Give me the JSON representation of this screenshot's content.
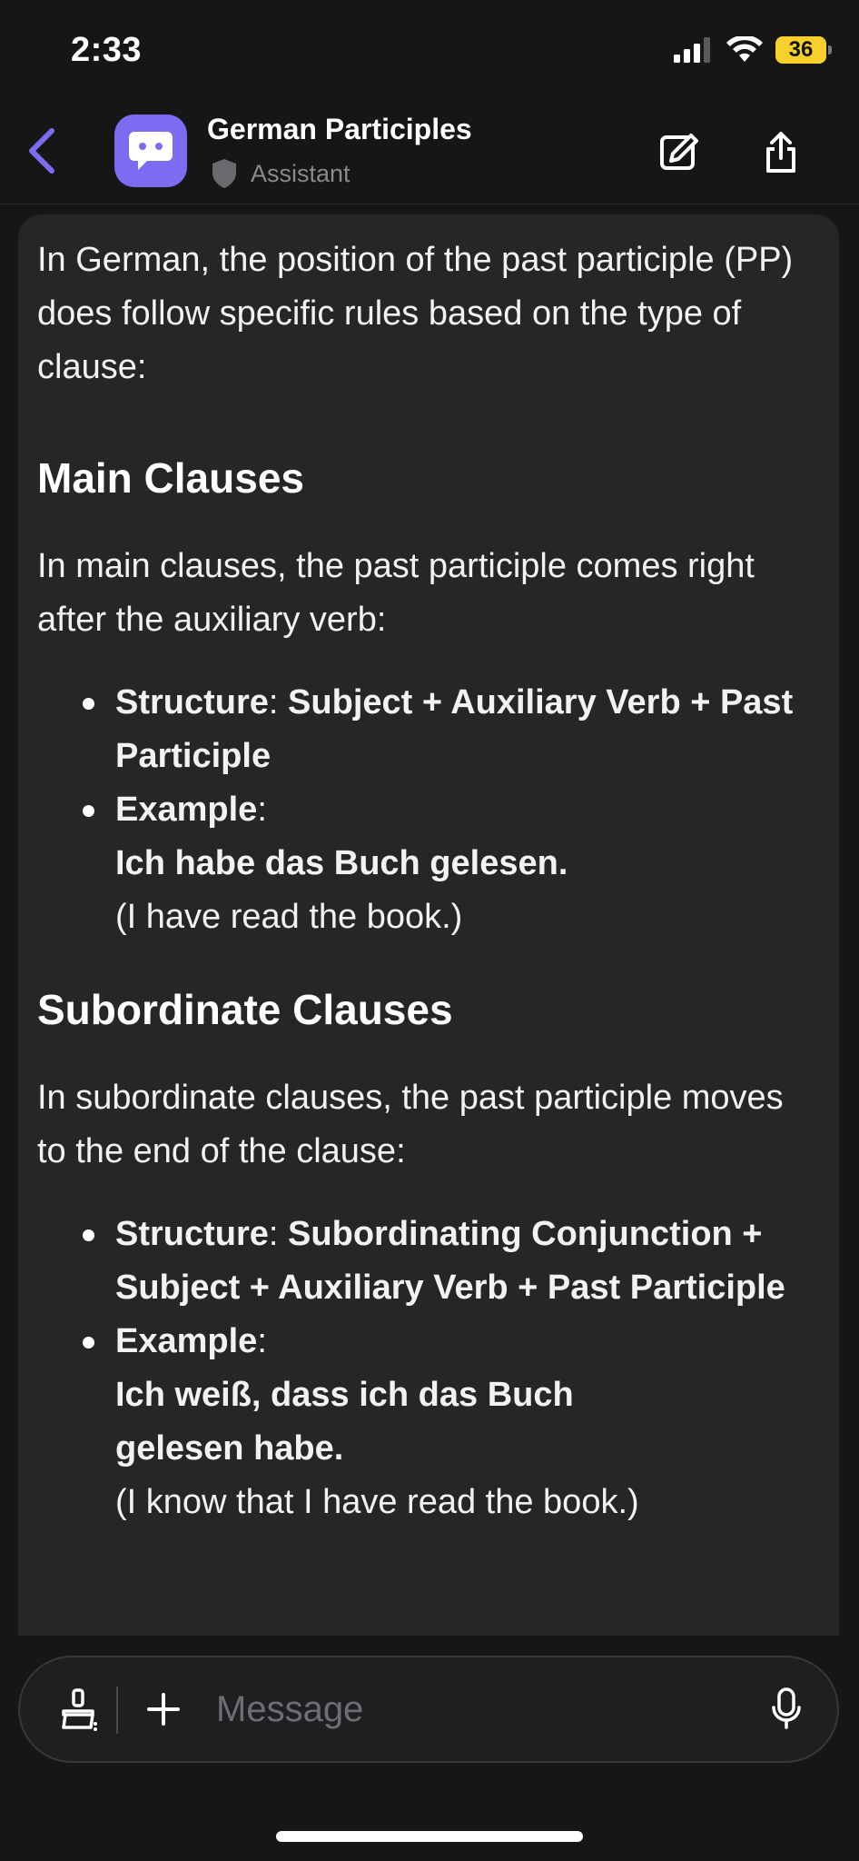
{
  "status_bar": {
    "time": "2:33",
    "battery": "36"
  },
  "header": {
    "title": "German Participles",
    "subtitle": "Assistant",
    "accent_color": "#7b6cf2"
  },
  "message": {
    "intro": "In German, the position of the past participle (PP) does follow specific rules based on the type of clause:",
    "sections": [
      {
        "heading": "Main Clauses",
        "paragraph": "In main clauses, the past participle comes right after the auxiliary verb:",
        "structure_label": "Structure",
        "structure_text": "Subject + Auxiliary Verb + Past Participle",
        "example_label": "Example",
        "example_de": "Ich habe das Buch gelesen.",
        "example_en": "(I have read the book.)"
      },
      {
        "heading": "Subordinate Clauses",
        "paragraph": "In subordinate clauses, the past participle moves to the end of the clause:",
        "structure_label": "Structure",
        "structure_text": "Subordinating Conjunction + Subject + Auxiliary Verb + Past Participle",
        "example_label": "Example",
        "example_de": "Ich weiß, dass ich das Buch gelesen habe.",
        "example_en": "(I know that I have read the book.)"
      }
    ]
  },
  "composer": {
    "placeholder": "Message"
  },
  "icons": {
    "back": "chevron-left-icon",
    "avatar": "chat-bot-icon",
    "shield": "shield-icon",
    "edit": "edit-icon",
    "share": "share-icon",
    "brush": "brush-icon",
    "plus": "plus-icon",
    "mic": "microphone-icon"
  }
}
